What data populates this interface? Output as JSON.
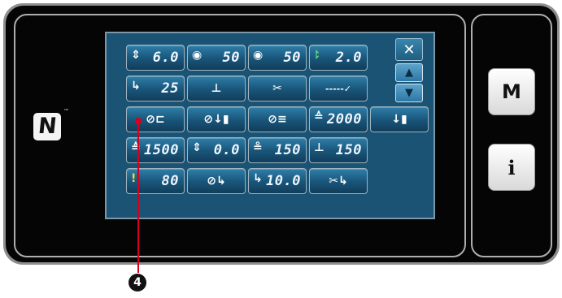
{
  "screen": {
    "rows": [
      [
        {
          "icon": "⇕",
          "value": "6.0",
          "name": "stitch-length-button"
        },
        {
          "icon": "◉",
          "value": "50",
          "name": "thread-tension-l-button"
        },
        {
          "icon": "◉",
          "value": "50",
          "name": "thread-tension-r-button"
        },
        {
          "icon": "⥏",
          "value": "2.0",
          "name": "needle-thread-button"
        }
      ],
      [
        {
          "icon": "↳",
          "value": "25",
          "name": "presser-foot-button"
        },
        {
          "icon": "⊥",
          "value": "",
          "name": "needle-stop-button"
        },
        {
          "icon": "✂",
          "value": "",
          "name": "thread-trim-button"
        },
        {
          "icon": "-----✓",
          "value": "",
          "name": "sewing-pattern-button"
        }
      ],
      [
        {
          "icon": "⊘⊏",
          "value": "",
          "name": "pedal-lock-button"
        },
        {
          "icon": "⊘↓▮",
          "value": "",
          "name": "needle-down-lock-button"
        },
        {
          "icon": "⊘≡",
          "value": "",
          "name": "thread-wiper-lock-button"
        },
        {
          "icon": "≙",
          "value": "2000",
          "name": "max-speed-button"
        },
        {
          "icon": "↓▮",
          "value": "",
          "name": "needle-position-button"
        }
      ],
      [
        {
          "icon": "≙",
          "value": "1500",
          "name": "speed-setting-button"
        },
        {
          "icon": "⇕",
          "value": "0.0",
          "name": "feed-offset-button"
        },
        {
          "icon": "≗",
          "value": "150",
          "name": "bobbin-counter-button"
        },
        {
          "icon": "⊥",
          "value": "150",
          "name": "stitch-counter-button"
        }
      ],
      [
        {
          "icon": "!",
          "value": "80",
          "name": "alarm-button"
        },
        {
          "icon": "⊘↳",
          "value": "",
          "name": "foot-lift-lock-button"
        },
        {
          "icon": "↳",
          "value": "10.0",
          "name": "foot-height-button"
        },
        {
          "icon": "✂↳",
          "value": "",
          "name": "trim-lift-button"
        }
      ]
    ],
    "nav": {
      "close": "✕",
      "up": "▲",
      "down": "▼"
    }
  },
  "side": {
    "mode_label": "M",
    "info_label": "i"
  },
  "nfc": {
    "mark": "N",
    "tm": "™"
  },
  "callout": {
    "number": "4"
  },
  "colors": {
    "accent": "#1b5374",
    "alert": "#d6001c"
  }
}
